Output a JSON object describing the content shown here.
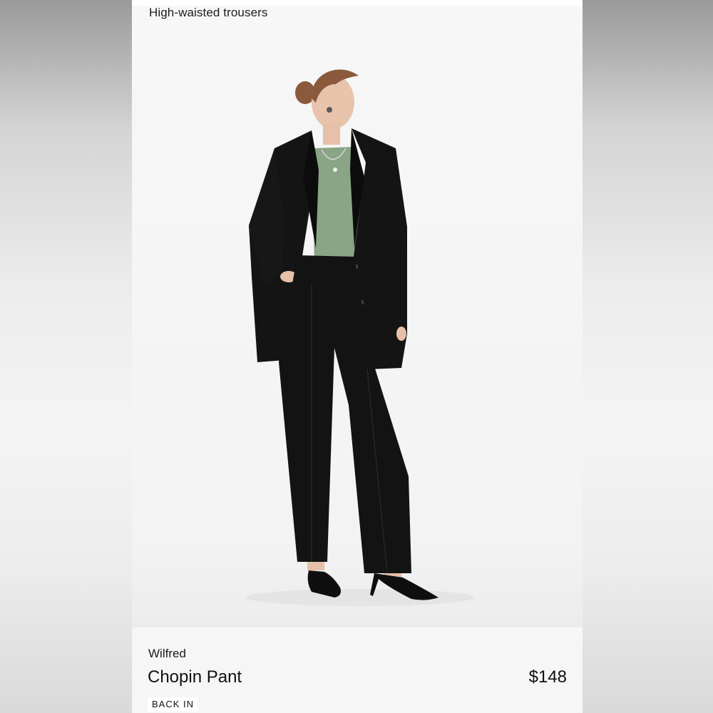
{
  "listing": {
    "caption": "High-waisted trousers",
    "brand": "Wilfred",
    "product_name": "Chopin Pant",
    "price": "$148",
    "badge": "BACK IN"
  },
  "photo": {
    "subject": "model-wearing-black-suit-and-green-top"
  },
  "colors": {
    "suit": "#141414",
    "top": "#8aa586",
    "background": "#f7f7f7"
  }
}
